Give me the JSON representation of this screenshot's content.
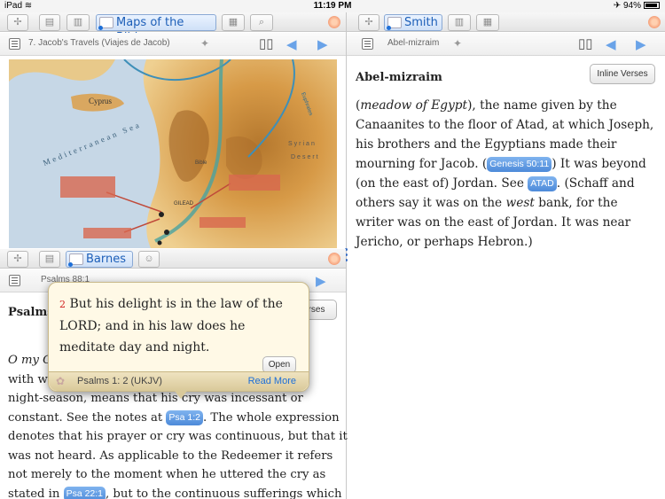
{
  "status": {
    "device": "iPad",
    "wifi_icon": "wifi-icon",
    "time": "11:19 PM",
    "battery": "94%",
    "battery_level": 0.94
  },
  "top_left": {
    "tabs": [
      "✢",
      "▤",
      "▥",
      "Maps of the Bible",
      "▦",
      "⌕"
    ],
    "active_tab": "Maps of the Bible",
    "title": "7. Jacob's Travels (Viajes de Jacob)"
  },
  "map": {
    "labels": {
      "cyprus": "Cyprus",
      "sea": "Mediterranean Sea",
      "syrian": "Syrian",
      "desert": "Desert",
      "bible": "Bible",
      "gilead": "GILEAD",
      "euphrates": "Euphrates"
    }
  },
  "right": {
    "tabs": [
      "✢",
      "Smith",
      "▥",
      "▦"
    ],
    "active_tab": "Smith",
    "title": "Abel-mizraim",
    "heading": "Abel-mizraim",
    "inline_verses": "Inline Verses",
    "body": {
      "p1": "(",
      "p1_italic": "meadow of Egypt",
      "p2": "), the name given by the Canaanites to the floor of Atad, at which Joseph, his brothers and the Egyptians made their mourning for Jacob. (",
      "tag1": "Genesis 50:11",
      "p3": ") It was beyond (on the east of) Jordan. See ",
      "tag2": "ATAD",
      "p4": ". (Schaff and others say it was on the ",
      "p4_italic": "west",
      "p5": " bank, for the writer was on the east of Jordan. It was near Jericho, or perhaps Hebron.)"
    }
  },
  "bottom_left": {
    "tabs": [
      "✢",
      "▤",
      "Barnes",
      "☺"
    ],
    "active_tab": "Barnes",
    "title": "Psalms 88:1",
    "heading": "Psalms",
    "verses_btn": "rses",
    "body": {
      "l1": "O my G",
      "l2": "with w",
      "l3": "night-season, means that his cry was incessant or",
      "l4a": "constant. See the notes at ",
      "tag1": "Psa 1:2",
      "l4b": ". The whole expression",
      "l5": "denotes that his prayer or cry was continuous, but that it",
      "l6": "was not heard. As applicable to the Redeemer it refers",
      "l7": "not merely to the moment when he uttered the cry as",
      "l8a": "stated in ",
      "tag2": "Psa 22:1",
      "l8b": ", but to the continuous sufferings which"
    }
  },
  "popup": {
    "verse_num": "2",
    "text": "But his delight is in the law of the LORD; and in his law does he meditate day and night.",
    "open": "Open",
    "reference": "Psalms 1: 2 (UKJV)",
    "read_more": "Read More"
  }
}
